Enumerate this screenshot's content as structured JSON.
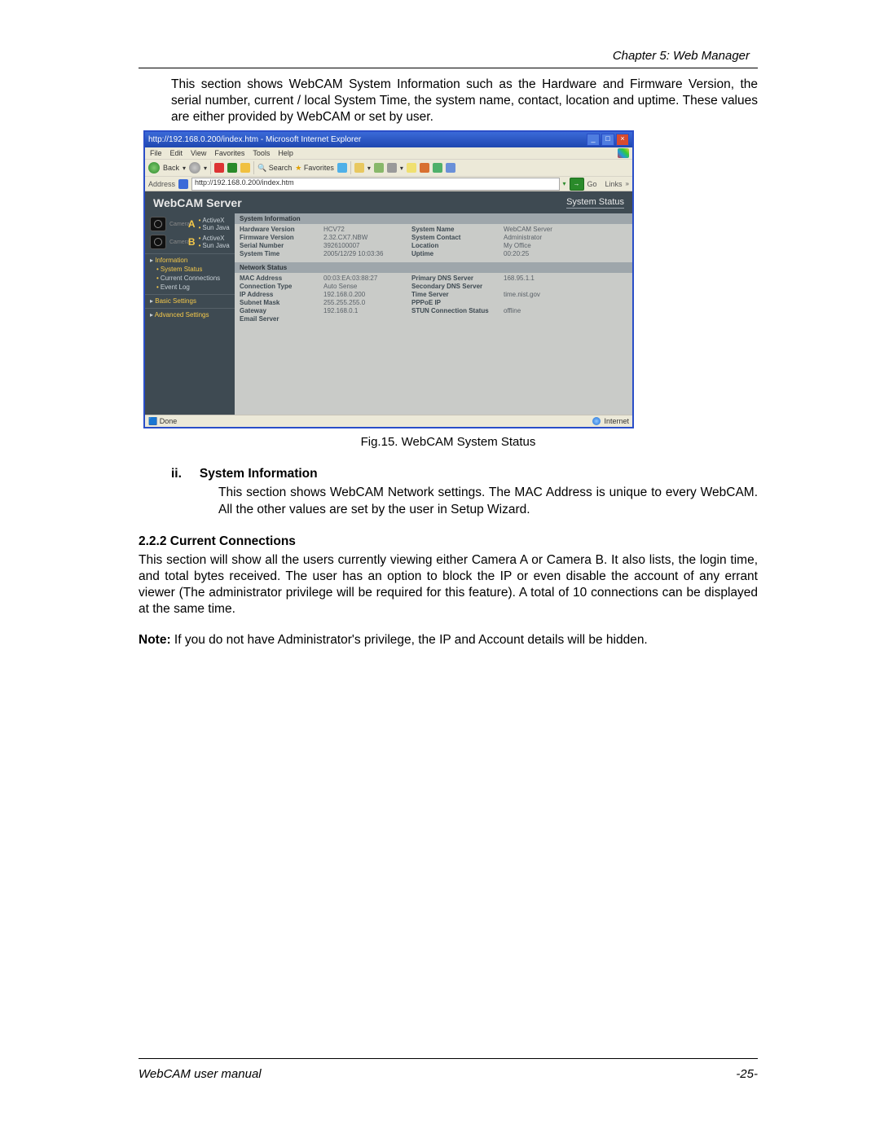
{
  "header": {
    "chapter": "Chapter 5: Web Manager"
  },
  "intro": "This section shows WebCAM System Information such as the Hardware and Firmware Version, the serial number, current / local System Time, the system name, contact, location and uptime. These values are either provided by WebCAM or set by user.",
  "figcaption": "Fig.15.  WebCAM System Status",
  "sec_ii": {
    "num": "ii.",
    "title": "System Information",
    "text": "This section shows WebCAM Network settings.    The MAC Address is unique to every WebCAM.    All the other values are set by the user in Setup Wizard."
  },
  "sec_222": {
    "title": "2.2.2 Current Connections",
    "p1": "This section will show all the users currently viewing either Camera A or Camera B. It also lists, the login time, and total bytes received.    The user has an option to block the IP or even disable the account of any errant viewer (The administrator privilege will be required for this feature).    A total of 10 connections can be displayed at the same time.",
    "p2_lead": "Note:",
    "p2": " If you do not have Administrator's privilege, the IP and Account details will be hidden."
  },
  "footer": {
    "left": "WebCAM user manual",
    "right": "-25-"
  },
  "shot": {
    "title": "http://192.168.0.200/index.htm - Microsoft Internet Explorer",
    "menus": [
      "File",
      "Edit",
      "View",
      "Favorites",
      "Tools",
      "Help"
    ],
    "back": "Back",
    "search": "Search",
    "favorites": "Favorites",
    "addr_label": "Address",
    "addr_value": "http://192.168.0.200/index.htm",
    "go": "Go",
    "links": "Links",
    "app_title": "WebCAM Server",
    "page_title": "System Status",
    "status_done": "Done",
    "status_zone": "Internet",
    "sidebar": {
      "camA": "A",
      "camB": "B",
      "activex": "ActiveX",
      "sunjava": "Sun Java",
      "information": "Information",
      "system_status": "System Status",
      "current_connections": "Current Connections",
      "event_log": "Event Log",
      "basic": "Basic Settings",
      "advanced": "Advanced Settings"
    },
    "sysinfo": {
      "title": "System Information",
      "rows": [
        [
          "Hardware Version",
          "HCV72",
          "System Name",
          "WebCAM Server"
        ],
        [
          "Firmware Version",
          "2.32.CX7.NBW",
          "System Contact",
          "Administrator"
        ],
        [
          "Serial Number",
          "3926100007",
          "Location",
          "My Office"
        ],
        [
          "System Time",
          "2005/12/29 10:03:36",
          "Uptime",
          "00:20:25"
        ]
      ]
    },
    "netstatus": {
      "title": "Network Status",
      "rows": [
        [
          "MAC Address",
          "00:03:EA:03:88:27",
          "Primary DNS Server",
          "168.95.1.1"
        ],
        [
          "Connection Type",
          "Auto Sense",
          "Secondary DNS Server",
          ""
        ],
        [
          "IP Address",
          "192.168.0.200",
          "Time Server",
          "time.nist.gov"
        ],
        [
          "Subnet Mask",
          "255.255.255.0",
          "PPPoE IP",
          ""
        ],
        [
          "Gateway",
          "192.168.0.1",
          "STUN Connection Status",
          "offline"
        ],
        [
          "Email Server",
          "",
          "",
          ""
        ]
      ]
    }
  }
}
